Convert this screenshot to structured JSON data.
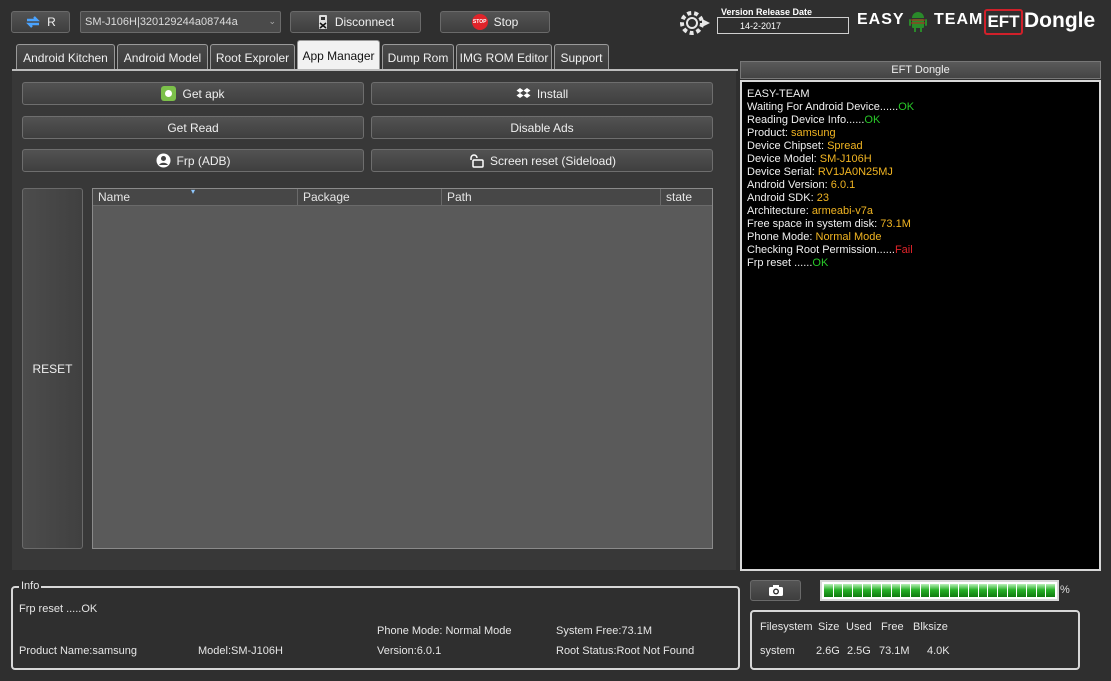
{
  "toolbar": {
    "r_label": "R",
    "device_select": "SM-J106H|320129244a08744a",
    "disconnect_label": "Disconnect",
    "stop_label": "Stop",
    "stop_badge": "STOP"
  },
  "brand": {
    "version_title": "Version Release Date",
    "version_date": "14-2-2017",
    "easy": "EASY",
    "team": "TEAM",
    "eft": "EFT",
    "dongle": "Dongle"
  },
  "tabs": [
    "Android Kitchen",
    "Android Model",
    "Root Exproler",
    "App Manager",
    "Dump Rom",
    "IMG ROM Editor",
    "Support"
  ],
  "actions": {
    "get_apk": "Get apk",
    "install": "Install",
    "get_read": "Get Read",
    "disable_ads": "Disable Ads",
    "frp_adb": "Frp (ADB)",
    "screen_reset": "Screen reset  (Sideload)",
    "reset": "RESET"
  },
  "table": {
    "columns": [
      "Name",
      "Package",
      "Path",
      "state"
    ]
  },
  "log": {
    "title": "EFT Dongle",
    "lines": [
      {
        "label": "EASY-TEAM",
        "value": "",
        "type": ""
      },
      {
        "label": "Waiting For Android Device......",
        "value": "OK",
        "type": "ok"
      },
      {
        "label": "Reading Device Info......",
        "value": "OK",
        "type": "ok"
      },
      {
        "label": "Product: ",
        "value": "samsung",
        "type": "y"
      },
      {
        "label": "Device Chipset: ",
        "value": "Spread",
        "type": "y"
      },
      {
        "label": "Device Model: ",
        "value": "SM-J106H",
        "type": "y"
      },
      {
        "label": "Device Serial: ",
        "value": "RV1JA0N25MJ",
        "type": "y"
      },
      {
        "label": "Android Version: ",
        "value": "6.0.1",
        "type": "y"
      },
      {
        "label": "Android SDK: ",
        "value": "23",
        "type": "y"
      },
      {
        "label": "Architecture: ",
        "value": "armeabi-v7a",
        "type": "y"
      },
      {
        "label": "Free space in system disk: ",
        "value": "73.1M",
        "type": "y"
      },
      {
        "label": "Phone Mode: ",
        "value": "Normal Mode",
        "type": "y"
      },
      {
        "label": "Checking Root Permission......",
        "value": "Fail",
        "type": "f"
      },
      {
        "label": "Frp reset ......",
        "value": "OK",
        "type": "ok"
      }
    ]
  },
  "info": {
    "legend": "Info",
    "frp": "Frp reset .....OK",
    "phone_mode": "Phone Mode: Normal Mode",
    "system_free": "System Free:73.1M",
    "product": "Product Name:samsung",
    "model": "Model:SM-J106H",
    "version": "Version:6.0.1",
    "root_status": "Root Status:Root Not Found"
  },
  "progress": {
    "value": 1.0,
    "suffix": "%"
  },
  "fs": {
    "headers": [
      "Filesystem",
      "Size",
      "Used",
      "Free",
      "Blksize"
    ],
    "row": [
      "system",
      "2.6G",
      "2.5G",
      "73.1M",
      "4.0K"
    ]
  }
}
